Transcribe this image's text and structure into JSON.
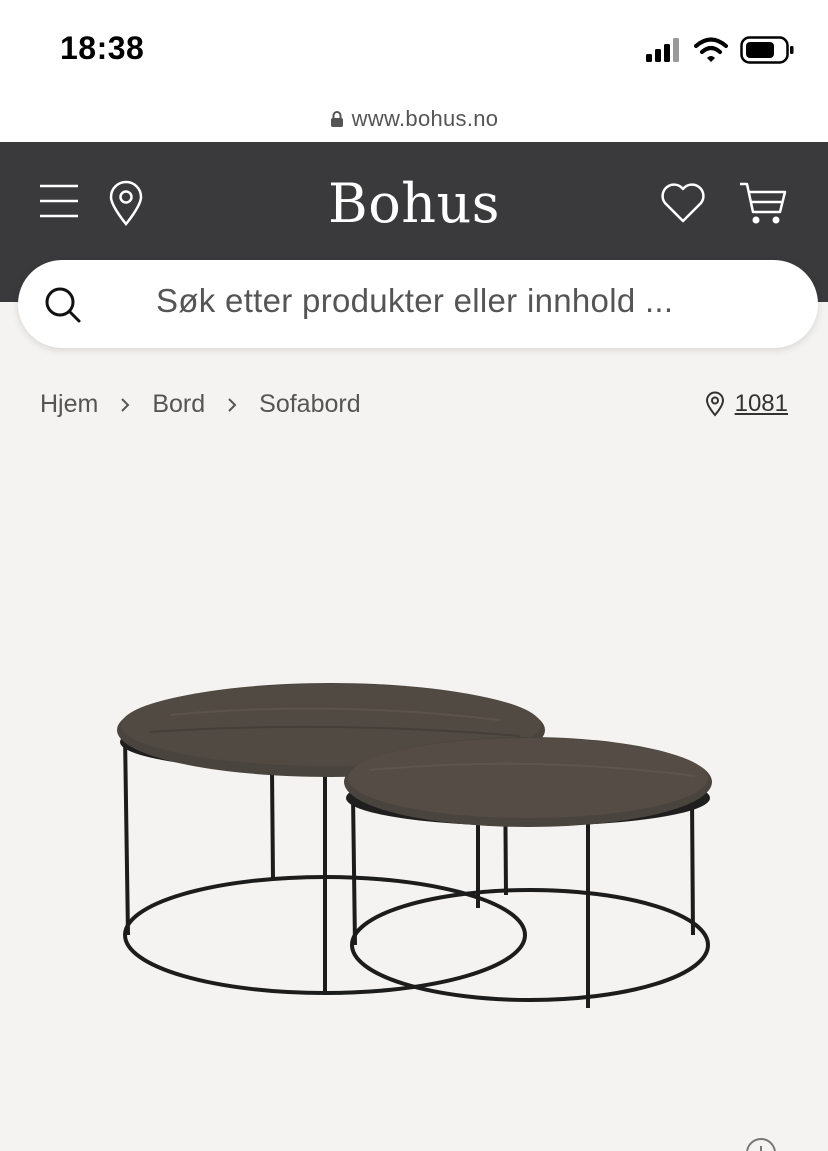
{
  "status_bar": {
    "time": "18:38"
  },
  "browser": {
    "url": "www.bohus.no"
  },
  "header": {
    "logo_text": "Bohus"
  },
  "search": {
    "placeholder": "Søk etter produkter eller innhold ..."
  },
  "breadcrumb": {
    "items": [
      "Hjem",
      "Bord",
      "Sofabord"
    ]
  },
  "store": {
    "code": "1081"
  },
  "product": {
    "image_alt": "Sofabord (two round coffee tables)"
  },
  "colors": {
    "header_bg": "#3a3a3d",
    "page_bg": "#f5f3f1"
  }
}
